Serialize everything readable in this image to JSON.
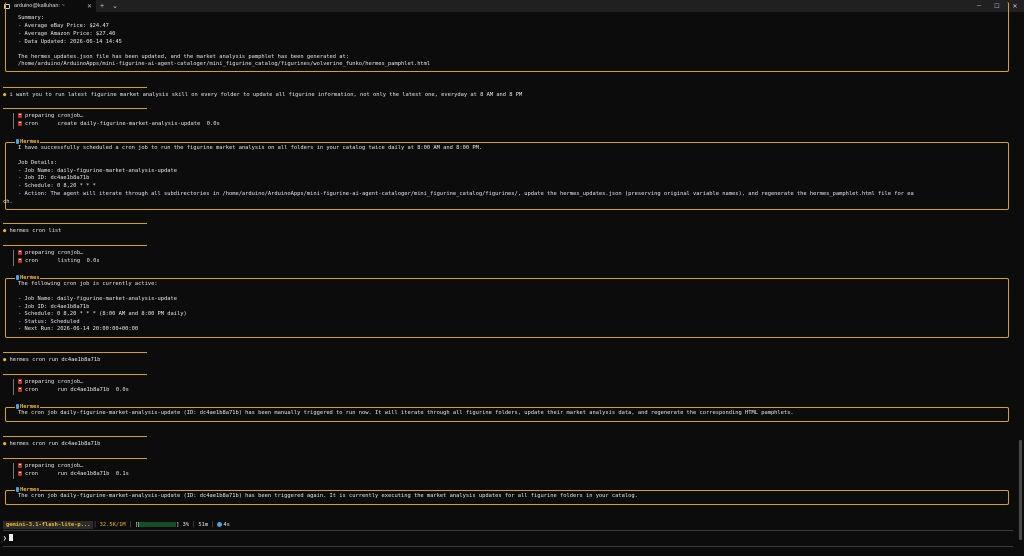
{
  "window": {
    "tab_title": "arduino@kalluhan: ~",
    "new_tab": "+",
    "dropdown": "⌄",
    "close_tab": "✕",
    "minimize": "─",
    "maximize": "☐",
    "close": "✕"
  },
  "history": {
    "summary": [
      "Summary:",
      "- Average eBay Price: $24.47",
      "- Average Amazon Price: $27.40",
      "- Data Updated: 2026-06-14 14:45"
    ],
    "result_line_1": "The hermes_updates.json file has been updated, and the market analysis pamphlet has been generated at:",
    "result_line_2": "/home/arduino/ArduinoApps/mini-figurine-ai-agent-cataloger/mini_figurine_catalog/figurines/wolverine_funko/hermes_pamphlet.html",
    "user_prompt_1": "i want you to run latest figurine market analysis skill on every folder to update all figurine information, not only the latest one, everyday at 8 AM and 8 PM",
    "tool_1a": "preparing cronjob…",
    "tool_1b": "cron      create daily-figurine-market-analysis-update  0.0s",
    "hermes_label": "Hermes",
    "reply_1": [
      "I have successfully scheduled a cron job to run the figurine market analysis on all folders in your catalog twice daily at 8:00 AM and 8:00 PM.",
      "",
      "Job Details:",
      "- Job Name: daily-figurine-market-analysis-update",
      "- Job ID: dc4ae1b8a71b",
      "- Schedule: 0 8,20 * * *",
      "- Action: The agent will iterate through all subdirectories in /home/arduino/ArduinoApps/mini-figurine-ai-agent-cataloger/mini_figurine_catalog/figurines/, update the hermes_updates.json (preserving original variable names), and regenerate the hermes_pamphlet.html file for ea"
    ],
    "reply_1_wrap": "ch.",
    "user_prompt_2": "hermes cron list",
    "tool_2a": "preparing cronjob…",
    "tool_2b": "cron      listing  0.0s",
    "reply_2": [
      "The following cron job is currently active:",
      "",
      "- Job Name: daily-figurine-market-analysis-update",
      "- Job ID: dc4ae1b8a71b",
      "- Schedule: 0 8,20 * * * (8:00 AM and 8:00 PM daily)",
      "- Status: Scheduled",
      "- Next Run: 2026-06-14 20:00:00+00:00"
    ],
    "user_prompt_3": "hermes cron run dc4ae1b8a71b",
    "tool_3a": "preparing cronjob…",
    "tool_3b": "cron      run dc4ae1b8a71b  0.0s",
    "reply_3": "The cron job daily-figurine-market-analysis-update (ID: dc4ae1b8a71b) has been manually triggered to run now. It will iterate through all figurine folders, update their market analysis data, and regenerate the corresponding HTML pamphlets.",
    "user_prompt_4": "hermes cron run dc4ae1b8a71b",
    "tool_4a": "preparing cronjob…",
    "tool_4b": "cron      run dc4ae1b8a71b  0.1s",
    "reply_4": "The cron job daily-figurine-market-analysis-update (ID: dc4ae1b8a71b) has been triggered again. It is currently executing the market analysis updates for all figurine folders in your catalog."
  },
  "statusbar": {
    "model": "gemini-3.1-flash-lite-p...",
    "tokens": "32.5K/1M",
    "context_open": "[",
    "context_close": "]",
    "context_percent": "3%",
    "context_fraction": 0.03,
    "elapsed": "51m",
    "cost": "4s",
    "separator": "│"
  },
  "prompt": {
    "symbol": "❯",
    "value": ""
  },
  "colors": {
    "accent": "#f2b824",
    "border": "#d6a21e",
    "background": "#0c0c0c",
    "tool_icon": "#c0392b",
    "hermes_icon": "#4aa3d8",
    "progress": "#3ec25f"
  }
}
